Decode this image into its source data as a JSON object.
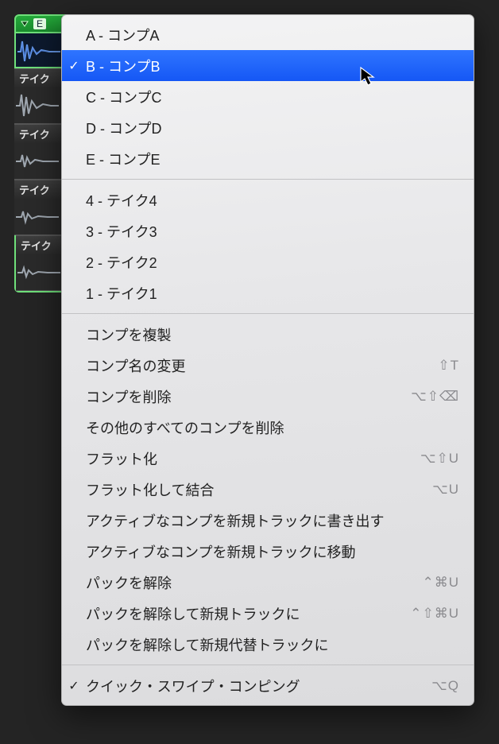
{
  "track_folder": {
    "comp_label_fragment": "E",
    "takes": [
      {
        "label": "テイク"
      },
      {
        "label": "テイク"
      },
      {
        "label": "テイク"
      },
      {
        "label": "テイク"
      }
    ]
  },
  "menu": {
    "comps": [
      {
        "label": "A - コンプA",
        "checked": false,
        "selected": false
      },
      {
        "label": "B - コンプB",
        "checked": true,
        "selected": true
      },
      {
        "label": "C - コンプC",
        "checked": false,
        "selected": false
      },
      {
        "label": "D - コンプD",
        "checked": false,
        "selected": false
      },
      {
        "label": "E - コンプE",
        "checked": false,
        "selected": false
      }
    ],
    "takes": [
      {
        "label": "4 - テイク4"
      },
      {
        "label": "3 - テイク3"
      },
      {
        "label": "2 - テイク2"
      },
      {
        "label": "1 - テイク1"
      }
    ],
    "actions": [
      {
        "label": "コンプを複製",
        "shortcut": ""
      },
      {
        "label": "コンプ名の変更",
        "shortcut": "⇧T"
      },
      {
        "label": "コンプを削除",
        "shortcut": "⌥⇧⌫"
      },
      {
        "label": "その他のすべてのコンプを削除",
        "shortcut": ""
      },
      {
        "label": "フラット化",
        "shortcut": "⌥⇧U"
      },
      {
        "label": "フラット化して結合",
        "shortcut": "⌥U"
      },
      {
        "label": "アクティブなコンプを新規トラックに書き出す",
        "shortcut": ""
      },
      {
        "label": "アクティブなコンプを新規トラックに移動",
        "shortcut": ""
      },
      {
        "label": "パックを解除",
        "shortcut": "⌃⌘U"
      },
      {
        "label": "パックを解除して新規トラックに",
        "shortcut": "⌃⇧⌘U"
      },
      {
        "label": "パックを解除して新規代替トラックに",
        "shortcut": ""
      }
    ],
    "footer": {
      "label": "クイック・スワイプ・コンピング",
      "shortcut": "⌥Q",
      "checked": true
    }
  }
}
